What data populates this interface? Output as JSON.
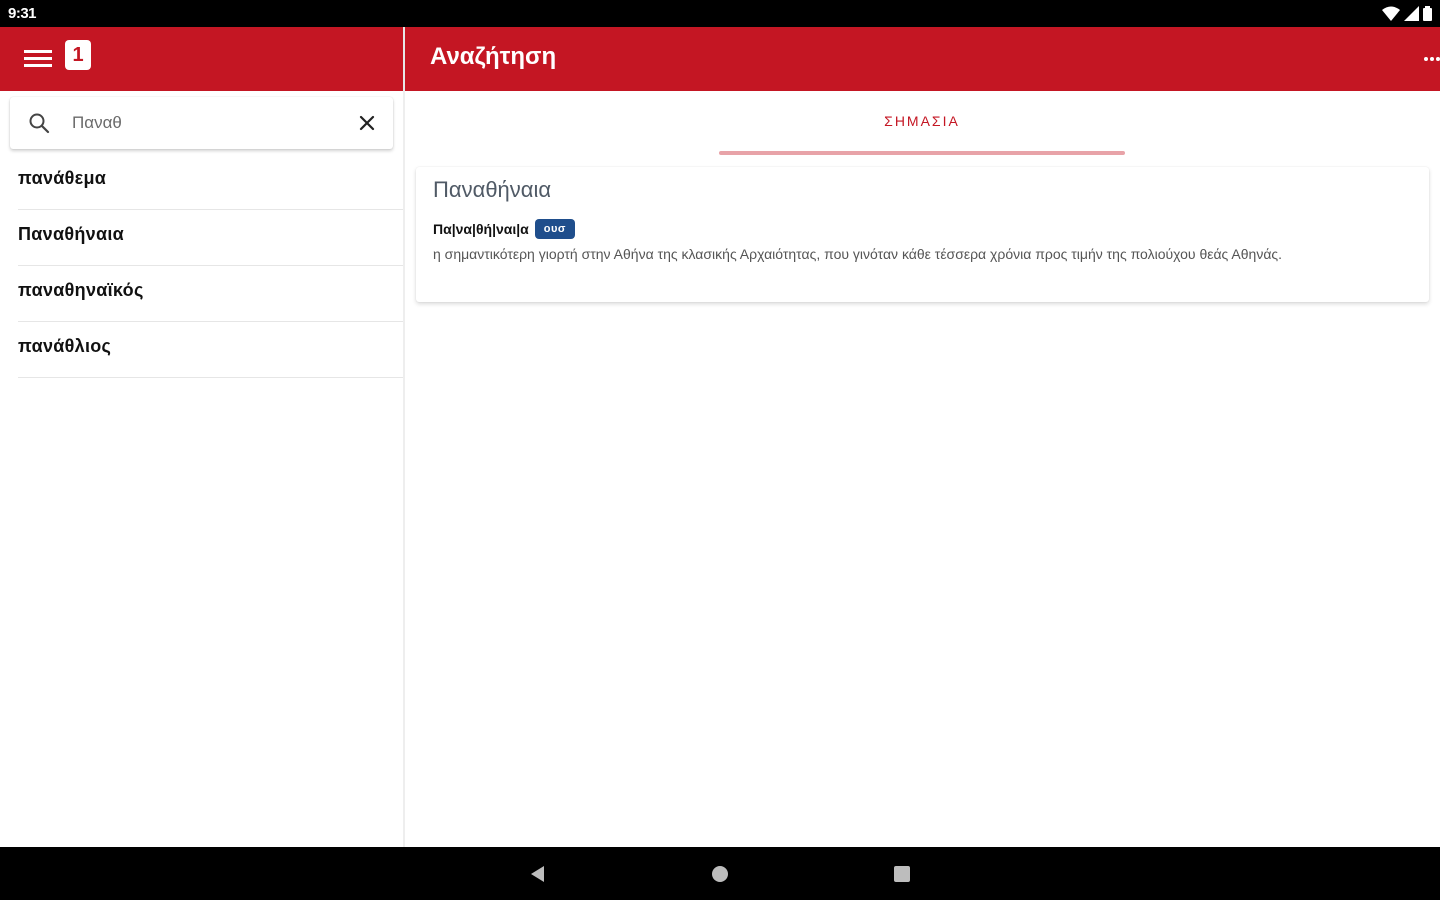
{
  "status_bar": {
    "time": "9:31",
    "icons": [
      "wifi-icon",
      "signal-icon",
      "battery-icon"
    ]
  },
  "app_bar": {
    "logo_text": "1",
    "title": "Αναζήτηση",
    "brand_color": "#c41623"
  },
  "search": {
    "value": "Παναθ",
    "placeholder": ""
  },
  "results": [
    {
      "label": "πανάθεμα"
    },
    {
      "label": "Παναθήναια"
    },
    {
      "label": "παναθηναϊκός"
    },
    {
      "label": "πανάθλιος"
    }
  ],
  "tabs": [
    {
      "label": "ΣΗΜΑΣΙΑ",
      "selected": true
    }
  ],
  "entry": {
    "headword": "Παναθήναια",
    "syllables": "Πα|να|θή|ναι|α",
    "part_of_speech": "ουσ",
    "definition": "η σημαντικότερη γιορτή στην Αθήνα της κλασικής Αρχαιότητας, που γινόταν κάθε τέσσερα χρόνια προς τιμήν της πολιούχου θεάς Αθηνάς."
  },
  "nav_bar": {
    "icons": [
      "back-icon",
      "home-icon",
      "recents-icon"
    ]
  }
}
